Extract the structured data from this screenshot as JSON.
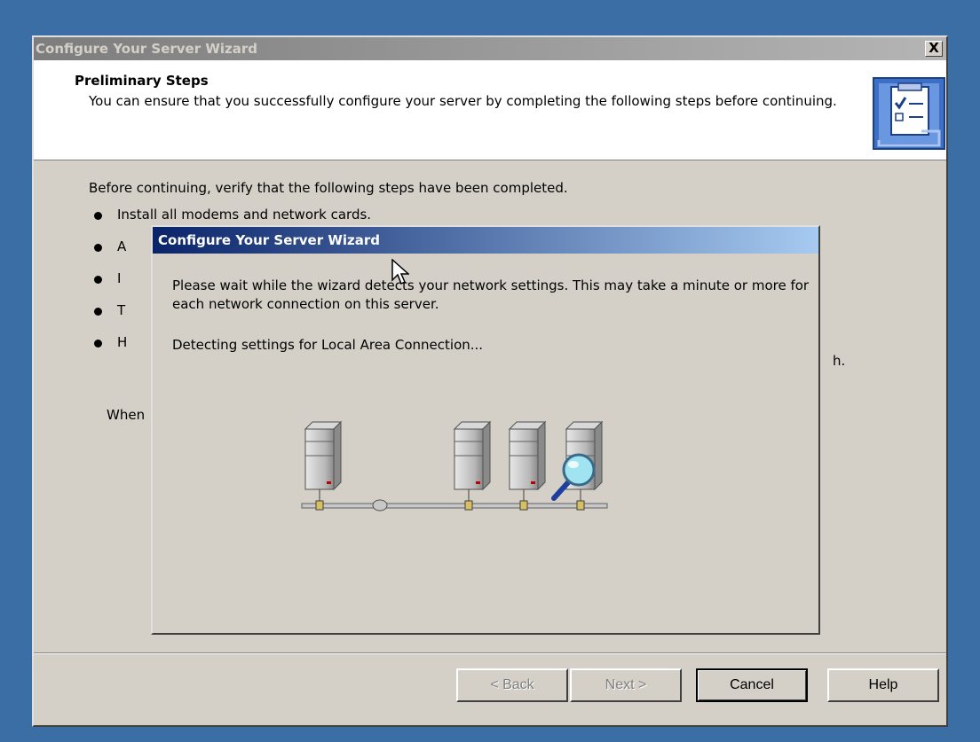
{
  "window": {
    "title": "Configure Your Server Wizard",
    "close_label": "X"
  },
  "header": {
    "title": "Preliminary Steps",
    "description": "You can ensure that you successfully configure your server by completing the following steps before continuing.",
    "icon": "checklist-clipboard-icon"
  },
  "content": {
    "intro": "Before continuing, verify that the following steps have been completed.",
    "bullets": [
      "Install all modems and network cards.",
      "A",
      "I",
      "T",
      "H"
    ],
    "bullet_tail": "h.",
    "when_text": "When"
  },
  "buttons": {
    "back": "< Back",
    "next": "Next >",
    "cancel": "Cancel",
    "help": "Help"
  },
  "dialog": {
    "title": "Configure Your Server Wizard",
    "message": "Please wait while the wizard detects your network settings. This may take a minute or more for each network connection on this server.",
    "status": "Detecting settings for Local Area Connection...",
    "animation": "network-detection-animation"
  },
  "colors": {
    "desktop": "#3a6ea5",
    "active_title_start": "#0a246a",
    "active_title_end": "#a6caf0",
    "inactive_title_start": "#7d7d7d",
    "inactive_title_end": "#b5b5b5",
    "face": "#d4d0c8"
  }
}
